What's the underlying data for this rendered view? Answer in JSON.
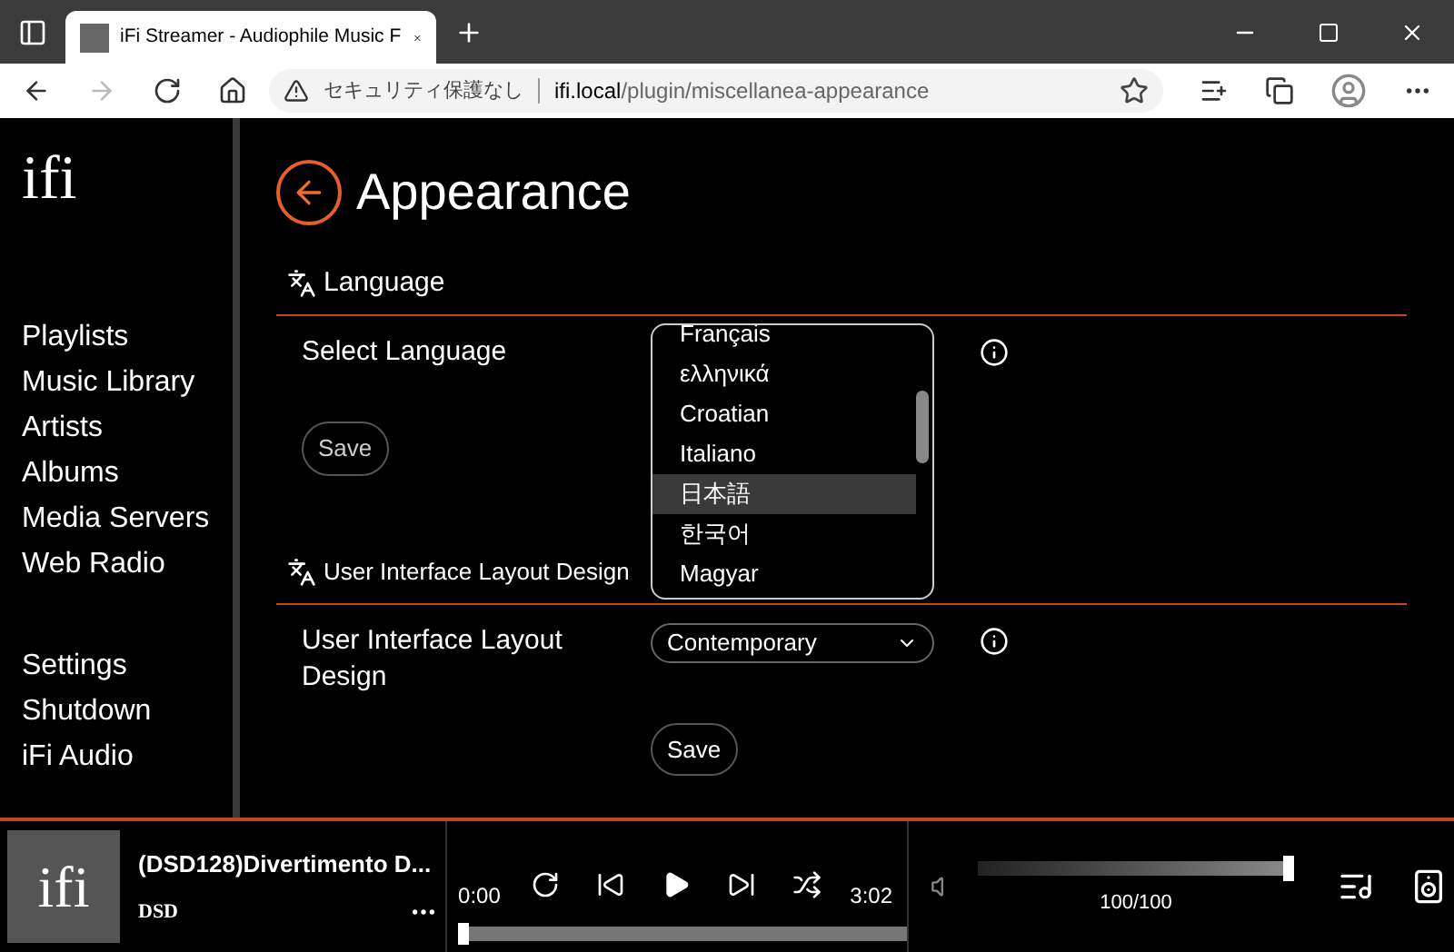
{
  "browser": {
    "tab_title": "iFi Streamer - Audiophile Music F",
    "security_label": "セキュリティ保護なし",
    "url_host": "ifi.local",
    "url_path": "/plugin/miscellanea-appearance"
  },
  "sidebar": {
    "logo": "ifi",
    "items": [
      "Playlists",
      "Music Library",
      "Artists",
      "Albums",
      "Media Servers",
      "Web Radio"
    ],
    "system_items": [
      "Settings",
      "Shutdown",
      "iFi Audio"
    ]
  },
  "page": {
    "title": "Appearance",
    "sections": [
      {
        "kind": "listbox",
        "heading": "Language",
        "label": "Select Language",
        "save": "Save",
        "options": [
          {
            "label": "Français",
            "selected": false
          },
          {
            "label": "ελληνικά",
            "selected": false
          },
          {
            "label": "Croatian",
            "selected": false
          },
          {
            "label": "Italiano",
            "selected": false
          },
          {
            "label": "日本語",
            "selected": true
          },
          {
            "label": "한국어",
            "selected": false
          },
          {
            "label": "Magyar",
            "selected": false
          }
        ]
      },
      {
        "kind": "select",
        "heading": "User Interface Layout Design",
        "label": "User Interface Layout Design",
        "value": "Contemporary",
        "save": "Save"
      }
    ]
  },
  "player": {
    "art_logo": "ifi",
    "title": "(DSD128)Divertimento D...",
    "format": "DSD",
    "elapsed": "0:00",
    "duration": "3:02",
    "progress": {
      "level": 0
    },
    "volume": {
      "level": 1,
      "reading": "100/100"
    }
  }
}
